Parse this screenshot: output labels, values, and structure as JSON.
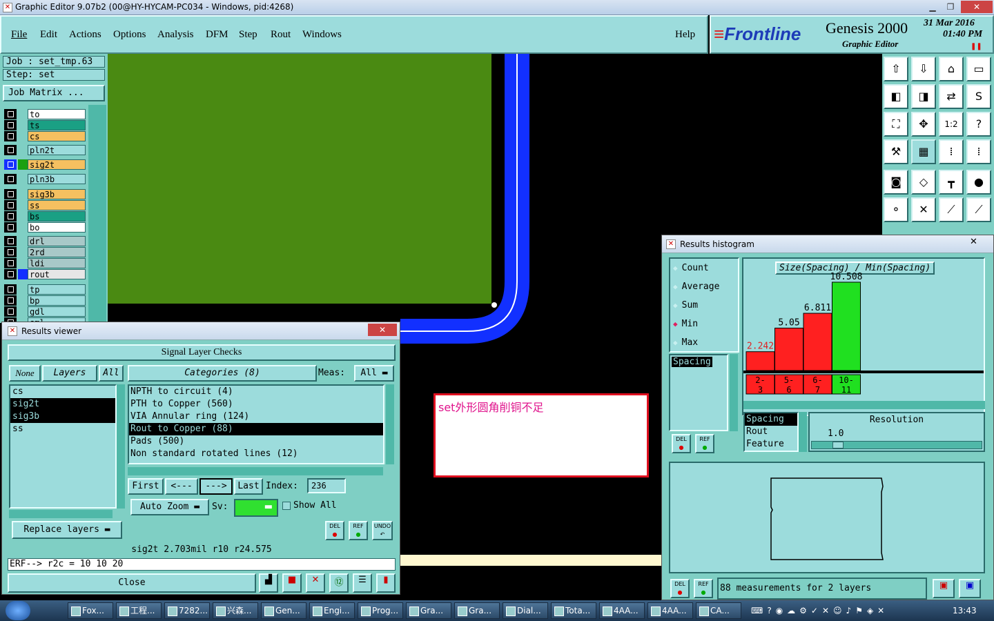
{
  "window": {
    "title": "Graphic Editor 9.07b2 (00@HY-HYCAM-PC034 - Windows, pid:4268)"
  },
  "menu": [
    "File",
    "Edit",
    "Actions",
    "Options",
    "Analysis",
    "DFM",
    "Step",
    "Rout",
    "Windows"
  ],
  "help": "Help",
  "logo": {
    "brand": "Frontline",
    "product": "Genesis 2000",
    "subtitle": "Graphic Editor",
    "date": "31 Mar 2016",
    "time": "01:40 PM"
  },
  "job": {
    "job_line": "Job : set_tmp.63",
    "step_line": "Step: set",
    "matrix_button": "Job Matrix ..."
  },
  "layers": [
    {
      "name": "to",
      "color": "#ffffff"
    },
    {
      "name": "ts",
      "color": "#1aa084"
    },
    {
      "name": "cs",
      "color": "#f5c060"
    },
    {
      "name": "pln2t",
      "color": "#9cdcdc"
    },
    {
      "name": "sig2t",
      "color": "#f5c060"
    },
    {
      "name": "pln3b",
      "color": "#9cdcdc"
    },
    {
      "name": "sig3b",
      "color": "#f5c060"
    },
    {
      "name": "ss",
      "color": "#f5c060"
    },
    {
      "name": "bs",
      "color": "#1aa084"
    },
    {
      "name": "bo",
      "color": "#ffffff"
    },
    {
      "name": "drl",
      "color": "#a8c8c8"
    },
    {
      "name": "2rd",
      "color": "#a8c8c8"
    },
    {
      "name": "ldi",
      "color": "#a8c8c8"
    },
    {
      "name": "rout",
      "color": "#e6e6e6"
    },
    {
      "name": "tp",
      "color": "#9cdcdc"
    },
    {
      "name": "bp",
      "color": "#9cdcdc"
    },
    {
      "name": "gdl",
      "color": "#9cdcdc"
    },
    {
      "name": "sml",
      "color": "#9cdcdc"
    }
  ],
  "annotation": {
    "text": "set外形圆角削铜不足"
  },
  "results_viewer": {
    "title": "Results viewer",
    "header": "Signal Layer Checks",
    "none_btn": "None",
    "layers_btn": "Layers",
    "all_btn": "All",
    "categories_btn": "Categories (8)",
    "meas_label": "Meas:",
    "meas_value": "All",
    "layer_list": [
      "cs",
      "sig2t",
      "sig3b",
      "ss"
    ],
    "categories": [
      "NPTH to circuit (4)",
      "PTH to Copper (560)",
      "VIA Annular ring (124)",
      "Rout to Copper (88)",
      "Pads (500)",
      "Non standard rotated lines (12)"
    ],
    "first": "First",
    "prev": "<---",
    "next": "--->",
    "last": "Last",
    "index_label": "Index:",
    "index_value": "236",
    "auto_zoom": "Auto Zoom",
    "sv_label": "Sv:",
    "show_all": "Show All",
    "replace_layers": "Replace layers",
    "del": "DEL",
    "ref": "REF",
    "undo": "UNDO",
    "status": "sig2t  2.703mil   r10   r24.575",
    "erf": "ERF--> r2c = 10 10 20",
    "close": "Close"
  },
  "histogram": {
    "title": "Results histogram",
    "options": [
      "Count",
      "Average",
      "Sum",
      "Min",
      "Max"
    ],
    "selected_option": "Min",
    "measure_list": [
      "Spacing"
    ],
    "chart_title": "Size(Spacing) / Min(Spacing)",
    "type_list": [
      "Spacing",
      "Rout",
      "Feature"
    ],
    "resolution_label": "Resolution",
    "resolution_value": "1.0",
    "del": "DEL",
    "ref": "REF",
    "status": "88 measurements for 2 layers"
  },
  "chart_data": {
    "type": "bar",
    "title": "Size(Spacing) / Min(Spacing)",
    "categories": [
      "2-3",
      "5-6",
      "6-7",
      "10-11"
    ],
    "values": [
      2.242,
      5.05,
      6.811,
      10.508
    ],
    "colors": [
      "#ff2020",
      "#ff2020",
      "#ff2020",
      "#20e020"
    ],
    "ylim": [
      0,
      10.508
    ]
  },
  "taskbar": {
    "items": [
      "Fox...",
      "工程...",
      "7282...",
      "兴森...",
      "Gen...",
      "Engi...",
      "Prog...",
      "Gra...",
      "Gra...",
      "Dial...",
      "Tota...",
      "4AA...",
      "4AA...",
      "CA..."
    ],
    "clock": "13:43"
  }
}
